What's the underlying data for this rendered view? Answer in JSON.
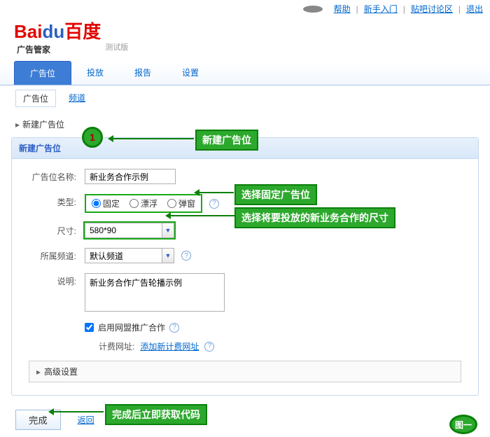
{
  "topbar": {
    "help": "帮助",
    "guide": "新手入门",
    "forum": "贴吧讨论区",
    "logout": "退出"
  },
  "logo": {
    "bai": "Bai",
    "du": "du",
    "hanzi": "百度",
    "sub": "广告管家",
    "beta": "测试版"
  },
  "nav": {
    "tab1": "广告位",
    "tab2": "投放",
    "tab3": "报告",
    "tab4": "设置"
  },
  "subnav": {
    "slot": "广告位",
    "channel": "频道"
  },
  "breadcrumb": "新建广告位",
  "panel_title": "新建广告位",
  "form": {
    "name_label": "广告位名称:",
    "name_value": "新业务合作示例",
    "type_label": "类型:",
    "type_opt1": "固定",
    "type_opt2": "漂浮",
    "type_opt3": "弹窗",
    "size_label": "尺寸:",
    "size_value": "580*90",
    "channel_label": "所属频道:",
    "channel_value": "默认频道",
    "desc_label": "说明:",
    "desc_value": "新业务合作广告轮播示例",
    "enable_union": "启用网盟推广合作",
    "fee_label": "计费网址:",
    "fee_link": "添加新计费网址",
    "advanced": "高级设置"
  },
  "actions": {
    "done": "完成",
    "back": "返回"
  },
  "annotations": {
    "a1": "新建广告位",
    "a2": "选择固定广告位",
    "a3": "选择将要投放的新业务合作的尺寸",
    "a4": "完成后立即获取代码",
    "badge1": "1",
    "figure": "图一"
  }
}
